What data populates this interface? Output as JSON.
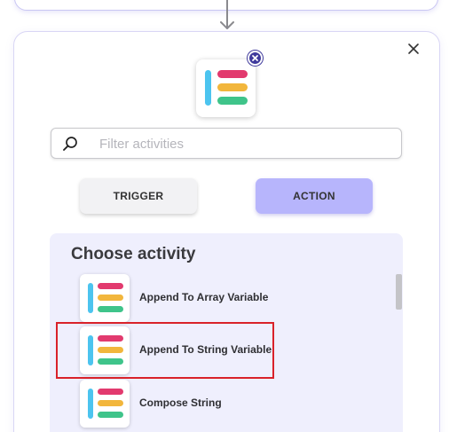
{
  "panel": {
    "close_icon": "close-icon",
    "selected_activity_icon": "activity-logo-icon",
    "remove_icon": "remove-badge-icon"
  },
  "search": {
    "placeholder": "Filter activities",
    "value": "",
    "icon": "search-icon"
  },
  "type_buttons": {
    "trigger_label": "TRIGGER",
    "action_label": "ACTION",
    "selected": "action"
  },
  "activity_list": {
    "heading": "Choose activity",
    "items": [
      {
        "label": "Append To Array Variable",
        "icon": "activity-logo-icon"
      },
      {
        "label": "Append To String Variable",
        "icon": "activity-logo-icon",
        "highlighted": true
      },
      {
        "label": "Compose String",
        "icon": "activity-logo-icon"
      }
    ]
  },
  "colors": {
    "accent": "#b7b5fc",
    "panel_bg": "#efeffd",
    "badge": "#3f3a9c",
    "logo_blue": "#4cc4ef",
    "logo_red": "#e23a6e",
    "logo_yellow": "#f2b63c",
    "logo_green": "#3fc48a",
    "highlight": "#d9222a"
  }
}
